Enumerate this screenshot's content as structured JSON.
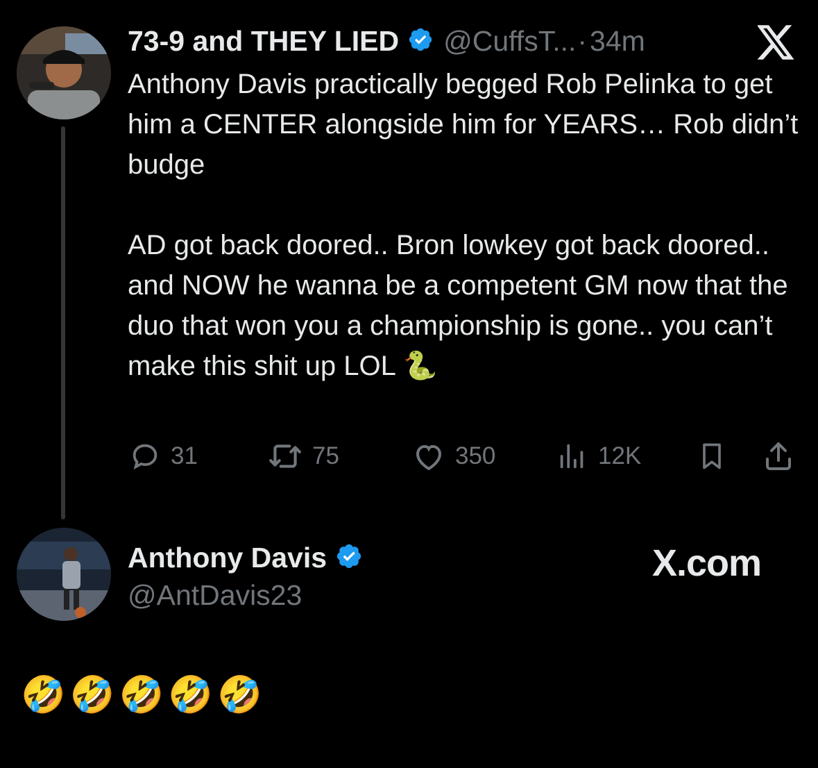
{
  "quoted_tweet": {
    "author_name": "73-9 and THEY LIED",
    "author_handle": "@CuffsT...",
    "separator": "·",
    "time": "34m",
    "text_paragraph_1": "Anthony Davis practically begged Rob Pelinka to get him a CENTER alongside him for YEARS… Rob didn’t budge",
    "text_paragraph_2": "AD got back doored.. Bron lowkey got back doored.. and NOW he wanna be a competent GM now that the duo that won you a championship is gone.. you can’t make this shit up LOL 🐍",
    "metrics": {
      "replies": "31",
      "reposts": "75",
      "likes": "350",
      "views": "12K"
    }
  },
  "reply_tweet": {
    "author_name": "Anthony Davis",
    "author_handle": "@AntDavis23",
    "source_label": "X.com",
    "text": "🤣🤣🤣🤣🤣"
  },
  "colors": {
    "background": "#000000",
    "primary_text": "#e7e9ea",
    "secondary_text": "#71767b",
    "verified_badge": "#1d9bf0",
    "thread_line": "#333639"
  },
  "icons": {
    "x_logo": "x-logo-icon",
    "verified": "verified-badge-icon",
    "reply": "reply-icon",
    "repost": "repost-icon",
    "like": "heart-icon",
    "views": "views-icon",
    "bookmark": "bookmark-icon",
    "share": "share-icon"
  }
}
